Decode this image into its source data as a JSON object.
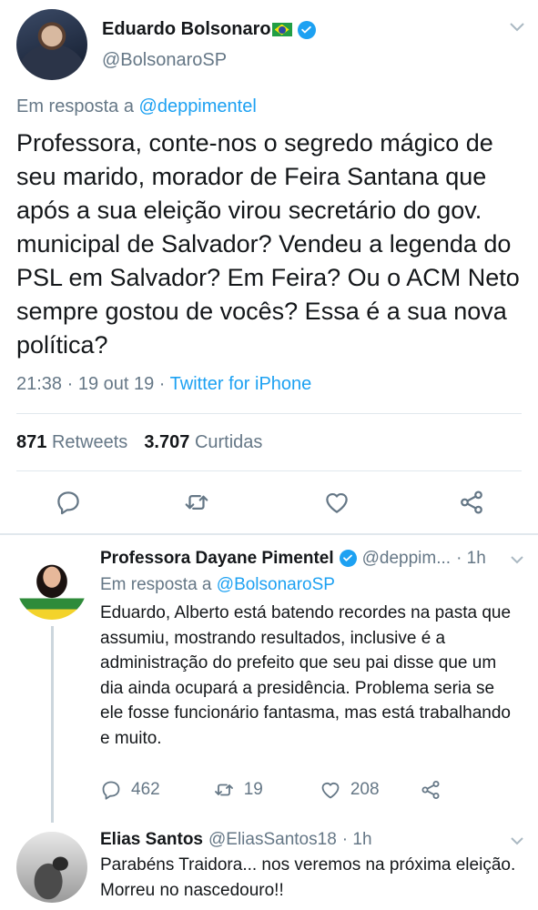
{
  "main_tweet": {
    "display_name": "Eduardo Bolsonaro",
    "handle": "@BolsonaroSP",
    "reply_prefix": "Em resposta a",
    "reply_mention": "@deppimentel",
    "text": "Professora, conte-nos o segredo mágico de seu marido, morador de Feira Santana que após a sua eleição virou secretário do gov. municipal de Salvador? Vendeu a legenda do PSL em Salvador? Em Feira? Ou o ACM Neto sempre gostou de vocês? Essa é a sua nova política?",
    "time_date": "21:38 · 19 out 19 ·",
    "source": "Twitter for iPhone",
    "retweets_count": "871",
    "retweets_label": "Retweets",
    "likes_count": "3.707",
    "likes_label": "Curtidas"
  },
  "replies": [
    {
      "display_name": "Professora Dayane Pimentel",
      "handle": "@deppim...",
      "time": "· 1h",
      "reply_prefix": "Em resposta a",
      "reply_mention": "@BolsonaroSP",
      "text": "Eduardo, Alberto está batendo recordes na pasta que assumiu, mostrando resultados, inclusive é a administração do prefeito que seu pai disse que um dia ainda ocupará a presidência. Problema seria se ele fosse funcionário fantasma, mas está trabalhando e muito.",
      "reply_count": "462",
      "retweet_count": "19",
      "like_count": "208"
    },
    {
      "display_name": "Elias Santos",
      "handle": "@EliasSantos18",
      "time": "· 1h",
      "text": "Parabéns Traidora... nos veremos na próxima eleição. Morreu no nascedouro!!"
    }
  ],
  "colors": {
    "accent": "#1da1f2",
    "muted": "#657786",
    "text": "#14171a",
    "divider": "#e1e8ed"
  },
  "icons": [
    "verified-badge-icon",
    "brazil-flag-icon",
    "chevron-down-icon",
    "reply-icon",
    "retweet-icon",
    "like-icon",
    "share-icon"
  ]
}
